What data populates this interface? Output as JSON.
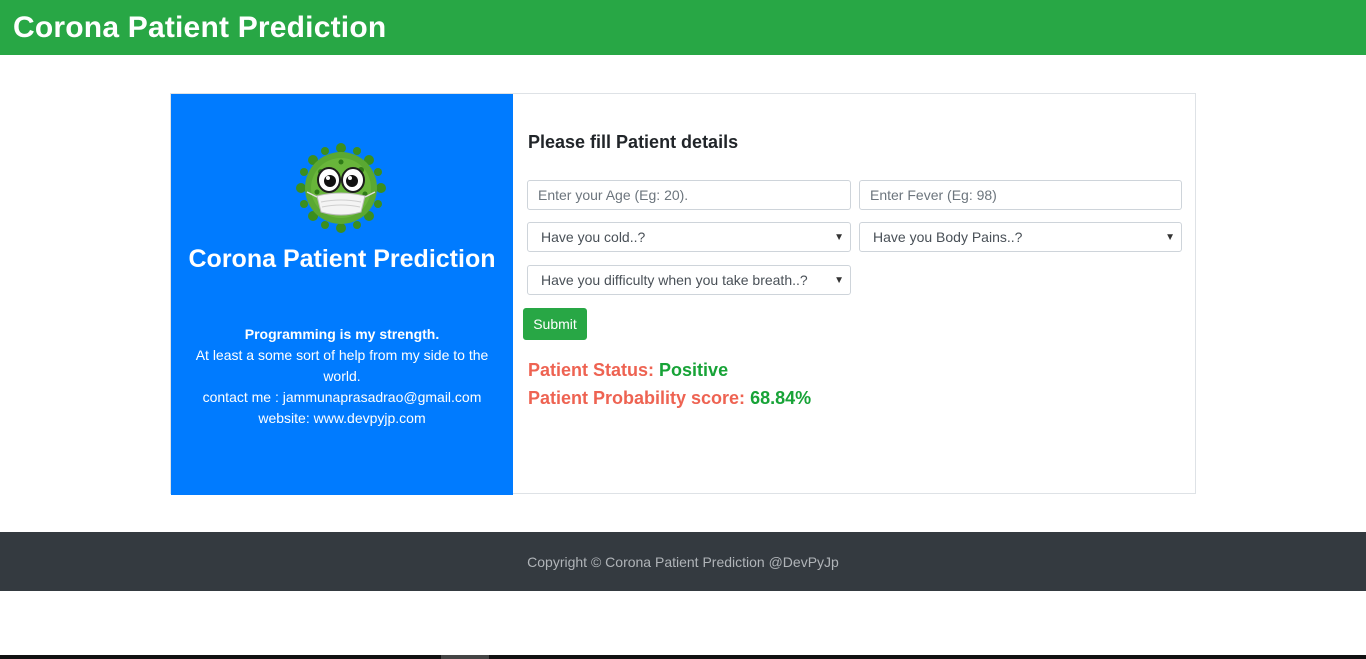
{
  "header": {
    "title": "Corona Patient Prediction"
  },
  "sidebar": {
    "logo_icon": "virus-mascot-icon",
    "title": "Corona Patient Prediction",
    "tagline": "Programming is my strength.",
    "description": "At least a some sort of help from my side to the world.",
    "contact": "contact me : jammunaprasadrao@gmail.com",
    "website": "website: www.devpyjp.com"
  },
  "form": {
    "title": "Please fill Patient details",
    "age_placeholder": "Enter your Age (Eg: 20).",
    "fever_placeholder": "Enter Fever (Eg: 98)",
    "cold_select": "Have you cold..?",
    "body_pains_select": "Have you Body Pains..?",
    "breath_select": "Have you difficulty when you take breath..?",
    "submit_label": "Submit"
  },
  "result": {
    "status_label": "Patient Status:",
    "status_value": "Positive",
    "score_label": "Patient Probability score:",
    "score_value": "68.84%"
  },
  "footer": {
    "copyright": "Copyright © Corona Patient Prediction @DevPyJp"
  },
  "colors": {
    "header_bg": "#28a745",
    "sidebar_bg": "#007bff",
    "footer_bg": "#343a40",
    "label_red": "#ee6352",
    "value_green": "#17a337"
  }
}
